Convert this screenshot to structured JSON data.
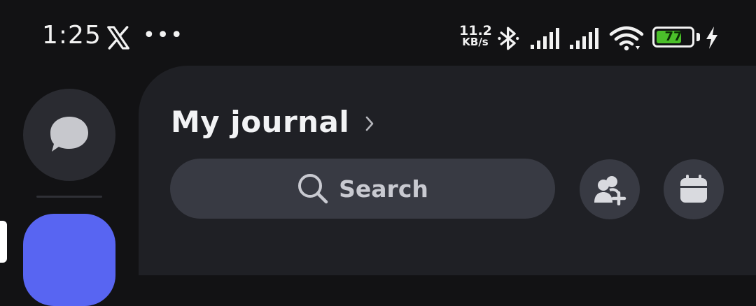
{
  "status_bar": {
    "time": "1:25",
    "net_speed_value": "11.2",
    "net_speed_unit": "KB/s",
    "battery_level": "77",
    "icons": [
      "x-icon",
      "more-dots-icon",
      "bluetooth-icon",
      "signal-icon",
      "signal-icon",
      "wifi-icon",
      "battery-icon",
      "charging-icon"
    ]
  },
  "rail": {
    "items": [
      "direct-messages-icon",
      "server-icon"
    ]
  },
  "header": {
    "title": "My journal"
  },
  "search": {
    "label": "Search"
  },
  "actions": {
    "icons": [
      "add-friend-icon",
      "calendar-icon"
    ]
  },
  "colors": {
    "background": "#121214",
    "panel": "#1f2025",
    "control": "#383a43",
    "accent": "#5865f2",
    "battery": "#4bbf2a"
  }
}
